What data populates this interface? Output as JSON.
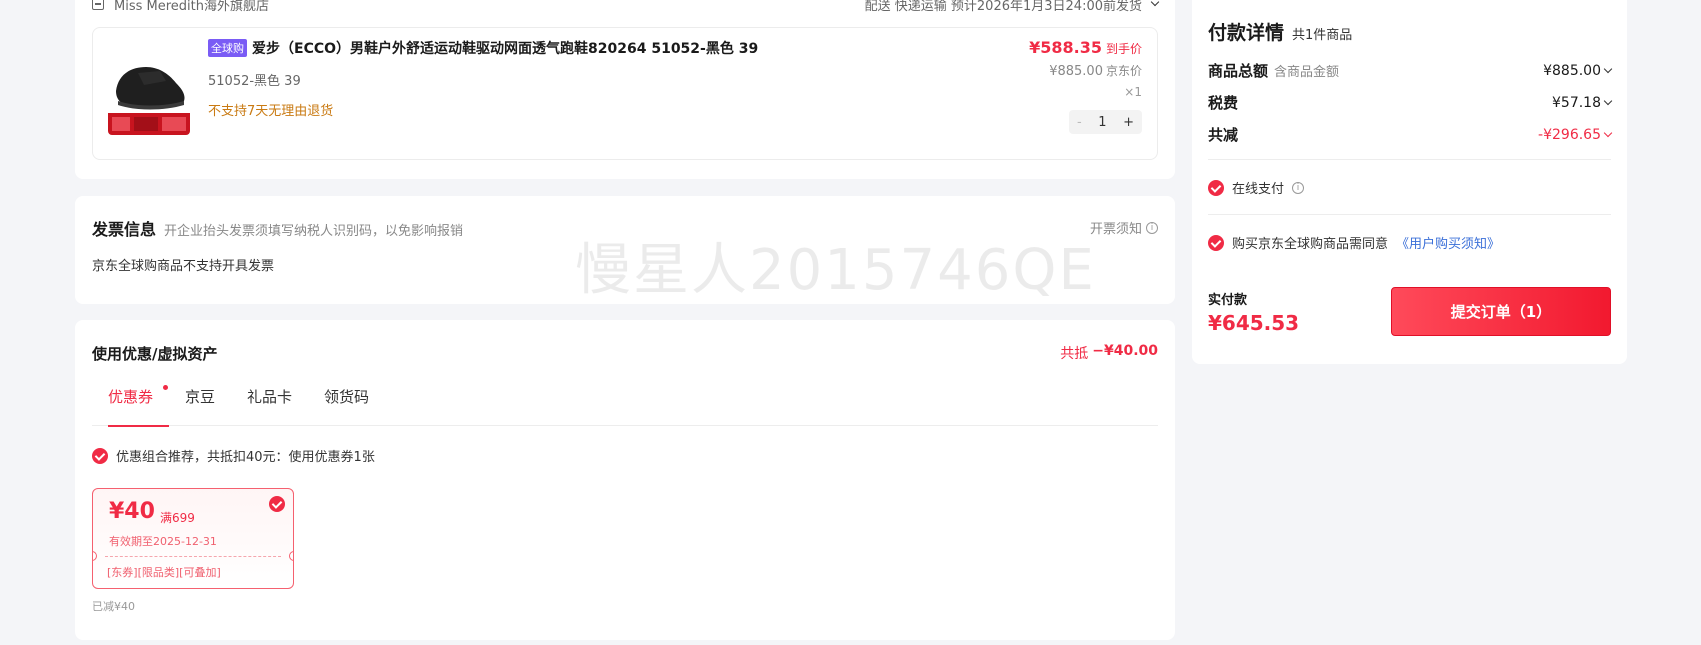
{
  "store": {
    "name": "Miss Meredith海外旗舰店",
    "delivery": "配送  快递运输  预计2026年1月3日24:00前发货"
  },
  "product": {
    "badge": "全球购",
    "title": "爱步（ECCO）男鞋户外舒适运动鞋驱动网面透气跑鞋820264 51052-黑色 39",
    "spec": "51052-黑色  39",
    "return_policy": "不支持7天无理由退货",
    "price": "¥588.35",
    "price_tag": "到手价",
    "jd_price": "¥885.00",
    "jd_price_tag": "京东价",
    "qty_label": "×1",
    "stepper": {
      "minus": "-",
      "value": "1",
      "plus": "+"
    }
  },
  "invoice": {
    "title": "发票信息",
    "tip": "开企业抬头发票须填写纳税人识别码，以免影响报销",
    "notice": "开票须知",
    "body": "京东全球购商品不支持开具发票"
  },
  "watermark": "慢星人2015746QE",
  "coupon_section": {
    "title": "使用优惠/虚拟资产",
    "total_label": "共抵",
    "total_value": "−¥40.00",
    "tabs": [
      {
        "label": "优惠券",
        "active": true
      },
      {
        "label": "京豆",
        "active": false
      },
      {
        "label": "礼品卡",
        "active": false
      },
      {
        "label": "领货码",
        "active": false
      }
    ],
    "recommendation": "优惠组合推荐，共抵扣40元：使用优惠券1张",
    "coupon": {
      "amount": "¥40",
      "condition": "满699",
      "valid": "有效期至2025-12-31",
      "tags": "[东券][限品类][可叠加]"
    },
    "reduced": "已减¥40"
  },
  "payment": {
    "title": "付款详情",
    "count": "共1件商品",
    "rows": [
      {
        "label": "商品总额",
        "sub": "含商品金额",
        "value": "¥885.00"
      },
      {
        "label": "税费",
        "sub": "",
        "value": "¥57.18"
      },
      {
        "label": "共减",
        "sub": "",
        "value": "-¥296.65"
      }
    ],
    "online_pay": "在线支付",
    "agree_text": "购买京东全球购商品需同意",
    "agree_link": "《用户购买须知》",
    "actual_label": "实付款",
    "actual_price": "¥645.53",
    "submit": "提交订单（1）"
  },
  "colors": {
    "accent_red": "#f02b45",
    "global_badge": "#7a5cf5",
    "return_text": "#c97a12",
    "link": "#3a6fd8"
  }
}
